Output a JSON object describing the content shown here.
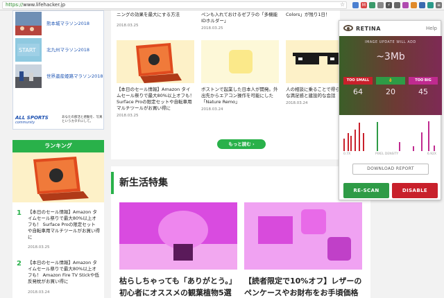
{
  "browser": {
    "url_scheme": "https://",
    "url_rest": "www.lifehacker.jp"
  },
  "left": {
    "races": [
      {
        "label": "熊本城マラソン2018"
      },
      {
        "label": "北九州マラソン2018"
      },
      {
        "label": "世界遺産姫路マラソン2018"
      }
    ],
    "allsports_logo": "ALL SPORTS",
    "allsports_sub": "community",
    "allsports_note": "あなたの部活と感動を、写真というカタチにして。",
    "ranking_title": "ランキング",
    "ranking": [
      {
        "num": "1",
        "title": "【本日のセール情報】Amazon タイムセール祭りで最大80%以上オフも！ Surface Proの限定セットや自転車用マルチツールがお買い得に",
        "date": "2018.03.25"
      },
      {
        "num": "2",
        "title": "【本日のセール情報】Amazon タイムセール祭りで最大80%以上オフも！ Amazon Fire TV Stickや低反発枕がお買い得に",
        "date": "2018.03.24"
      }
    ]
  },
  "grid": {
    "top_cards": [
      {
        "title": "ニングの効果を最大にする方法",
        "date": "2018.03.25"
      },
      {
        "title": "ペンも入れておけるゼブラの「多機能IDホルダー」",
        "date": "2018.03.25"
      },
      {
        "title": "Colors」が残り1日！",
        "date": "2018.03.25"
      }
    ],
    "cards": [
      {
        "title": "【本日のセール情報】Amazon タイムセール祭りで最大80%以上オフも！ Surface Proの限定セットや自転車用マルチツールがお買い得に",
        "date": "2018.03.25"
      },
      {
        "title": "ボストンで起業した日本人が開発。外出先からエアコン操作を可能にした「Nature Remo」",
        "date": "2018.03.24"
      },
      {
        "title": "人の相談に乗ることで得られる、大きな満足感と建設的な会話",
        "date": "2018.03.24"
      }
    ],
    "more_label": "もっと読む"
  },
  "section": {
    "title": "新生活特集",
    "cards": [
      {
        "title": "枯らしちゃっても「ありがとう。」初心者にオススメの観葉植物5選と"
      },
      {
        "title": "【読者限定で10%オフ】レザーのペンケースやお財布をお手頃価格"
      }
    ]
  },
  "retina": {
    "brand": "RETINA",
    "help": "Help",
    "hero_label": "IMAGE UPDATE WILL ADD",
    "hero_value": "~3Mb",
    "stats": [
      {
        "caption": "TOO SMALL",
        "value": "64",
        "color": "#c8202b"
      },
      {
        "caption": "👌",
        "value": "20",
        "color": "#2e9b46"
      },
      {
        "caption": "TOO BIG",
        "value": "45",
        "color": "#c02a8f"
      }
    ],
    "axis_left": "0.7X",
    "axis_mid": "PIXEL DENSITY",
    "axis_right": "6.92X",
    "density_bars": [
      {
        "h": 0.36,
        "color": "#c8202b"
      },
      {
        "h": 0.52,
        "color": "#c8202b"
      },
      {
        "h": 0.44,
        "color": "#c8202b"
      },
      {
        "h": 0.62,
        "color": "#c8202b"
      },
      {
        "h": 0.82,
        "color": "#c8202b"
      },
      {
        "h": 0.52,
        "color": "#c8202b"
      },
      {
        "h": 0.84,
        "color": "#2e9b46"
      },
      {
        "h": 0.26,
        "color": "#c02a8f"
      },
      {
        "h": 0.14,
        "color": "#c02a8f"
      },
      {
        "h": 0.54,
        "color": "#c02a8f"
      },
      {
        "h": 0.86,
        "color": "#c02a8f"
      },
      {
        "h": 0.16,
        "color": "#c02a8f"
      }
    ],
    "report_label": "DOWNLOAD REPORT",
    "rescan_label": "RE-SCAN",
    "disable_label": "DISABLE"
  }
}
